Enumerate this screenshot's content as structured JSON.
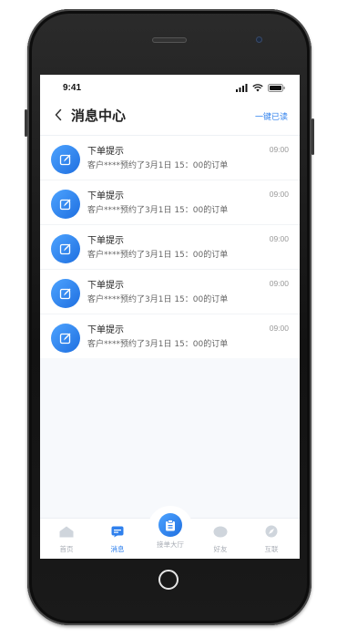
{
  "status": {
    "time": "9:41"
  },
  "header": {
    "title": "消息中心",
    "mark_all_read": "一键已读"
  },
  "messages": [
    {
      "title": "下单提示",
      "text": "客户****预约了3月1日 15：00的订单",
      "time": "09:00"
    },
    {
      "title": "下单提示",
      "text": "客户****预约了3月1日 15：00的订单",
      "time": "09:00"
    },
    {
      "title": "下单提示",
      "text": "客户****预约了3月1日 15：00的订单",
      "time": "09:00"
    },
    {
      "title": "下单提示",
      "text": "客户****预约了3月1日 15：00的订单",
      "time": "09:00"
    },
    {
      "title": "下单提示",
      "text": "客户****预约了3月1日 15：00的订单",
      "time": "09:00"
    }
  ],
  "tabbar": {
    "home": "首页",
    "messages": "消息",
    "order_hall": "接单大厅",
    "friends": "好友",
    "interconnect": "互联"
  },
  "colors": {
    "accent": "#2f80ed",
    "icon_gradient_start": "#4da3ff",
    "icon_gradient_end": "#1f6fe0"
  }
}
